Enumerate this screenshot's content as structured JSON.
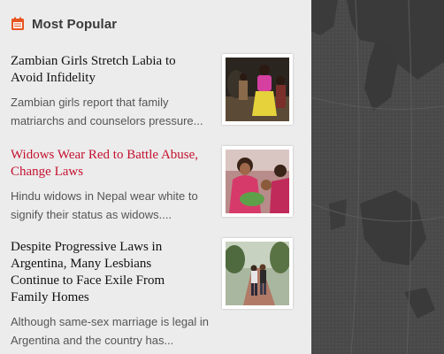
{
  "section": {
    "title": "Most Popular",
    "icon": "calendar-icon",
    "accent_color": "#e8541e"
  },
  "articles": [
    {
      "title": "Zambian Girls Stretch Labia to Avoid Infidelity",
      "excerpt": "Zambian girls report that family matriarchs and counselors pressure...",
      "highlighted": false
    },
    {
      "title": "Widows Wear Red to Battle Abuse, Change Laws",
      "excerpt": "Hindu widows in Nepal wear white to signify their status as widows....",
      "highlighted": true
    },
    {
      "title": "Despite Progressive Laws in Argentina, Many Lesbians Continue to Face Exile From Family Homes",
      "excerpt": "Although same-sex marriage is legal in Argentina and the country has...",
      "highlighted": false
    }
  ],
  "colors": {
    "title_default": "#111111",
    "title_highlight": "#c4122f",
    "panel_bg": "#ececec",
    "map_bg": "#4b4b4b"
  }
}
